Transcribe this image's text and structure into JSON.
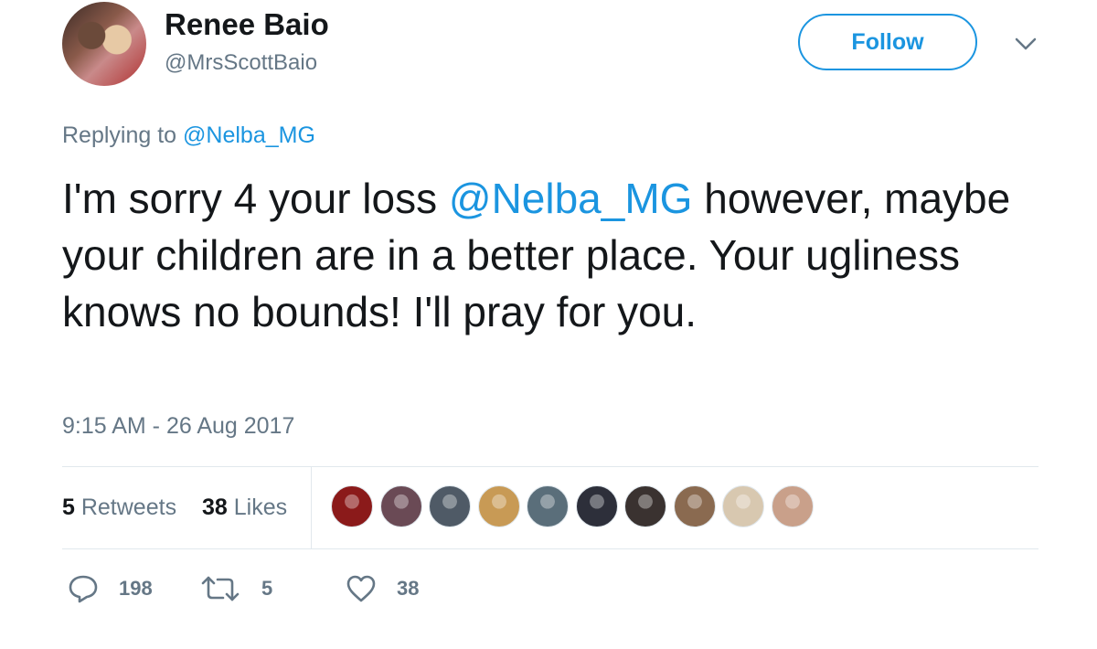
{
  "user": {
    "name": "Renee Baio",
    "handle": "@MrsScottBaio"
  },
  "follow_label": "Follow",
  "replying": {
    "prefix": "Replying to ",
    "mention": "@Nelba_MG"
  },
  "tweet": {
    "part1": "I'm sorry 4 your loss ",
    "mention": "@Nelba_MG",
    "part2": " however, maybe your children are in a better place. Your ugliness knows no bounds! I'll pray for you."
  },
  "timestamp": "9:15 AM - 26 Aug 2017",
  "stats": {
    "retweets_count": "5",
    "retweets_label": " Retweets",
    "likes_count": "38",
    "likes_label": " Likes"
  },
  "likers": [
    "#8b1a1a",
    "#6a4a55",
    "#4f5a66",
    "#c89a55",
    "#5a6e7a",
    "#2d2f3a",
    "#3a3230",
    "#8a6a50",
    "#d8c8b0",
    "#c9a08a"
  ],
  "actions": {
    "replies": "198",
    "retweets": "5",
    "likes": "38"
  },
  "icons": {
    "reply": "reply-icon",
    "retweet": "retweet-icon",
    "like": "heart-icon",
    "caret": "chevron-down-icon"
  },
  "colors": {
    "accent": "#1b95e0",
    "muted": "#657786",
    "text": "#14171a"
  }
}
